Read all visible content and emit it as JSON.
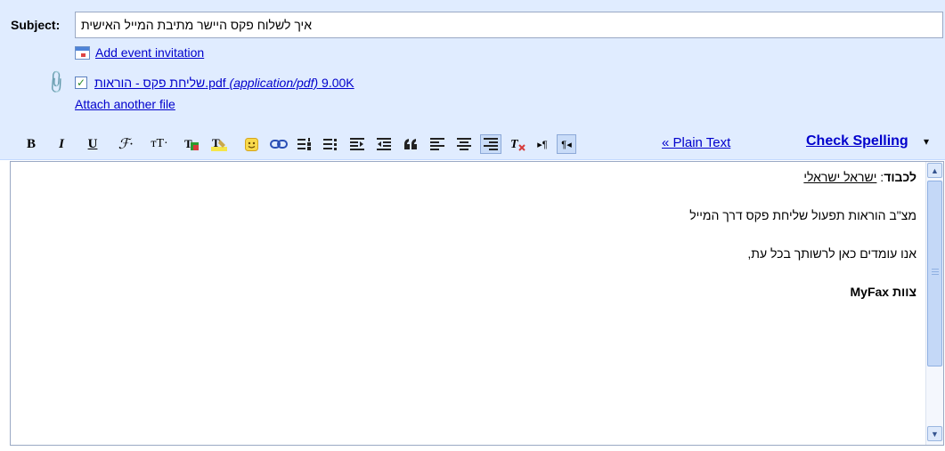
{
  "subject": {
    "label": "Subject:",
    "value": "איך לשלוח פקס היישר מתיבת המייל האישית"
  },
  "attachments": {
    "add_event_invitation": "Add event invitation",
    "file": {
      "checked": true,
      "name": "שליחת פקס - הוראות.pdf",
      "type": "(application/pdf)",
      "size": "9.00K"
    },
    "attach_another": "Attach another file"
  },
  "toolbar": {
    "bold": "B",
    "italic": "I",
    "underline": "U",
    "font": "ℱ·",
    "size": "тT·",
    "plain_text_link": "« Plain Text",
    "check_spelling": "Check Spelling",
    "check_spelling_arrow": "▾"
  },
  "body": {
    "greeting_label": "לכבוד",
    "greeting_colon": ":",
    "recipient": "ישראל ישראלי",
    "line1": "מצ\"ב הוראות תפעול שליחת פקס דרך המייל",
    "line2": "אנו עומדים כאן לרשותך בכל עת,",
    "signature": "צוות MyFax"
  },
  "icons": {
    "calendar": "calendar-icon",
    "attachment": "paperclip-icon",
    "scroll_up": "▲",
    "scroll_down": "▼"
  }
}
